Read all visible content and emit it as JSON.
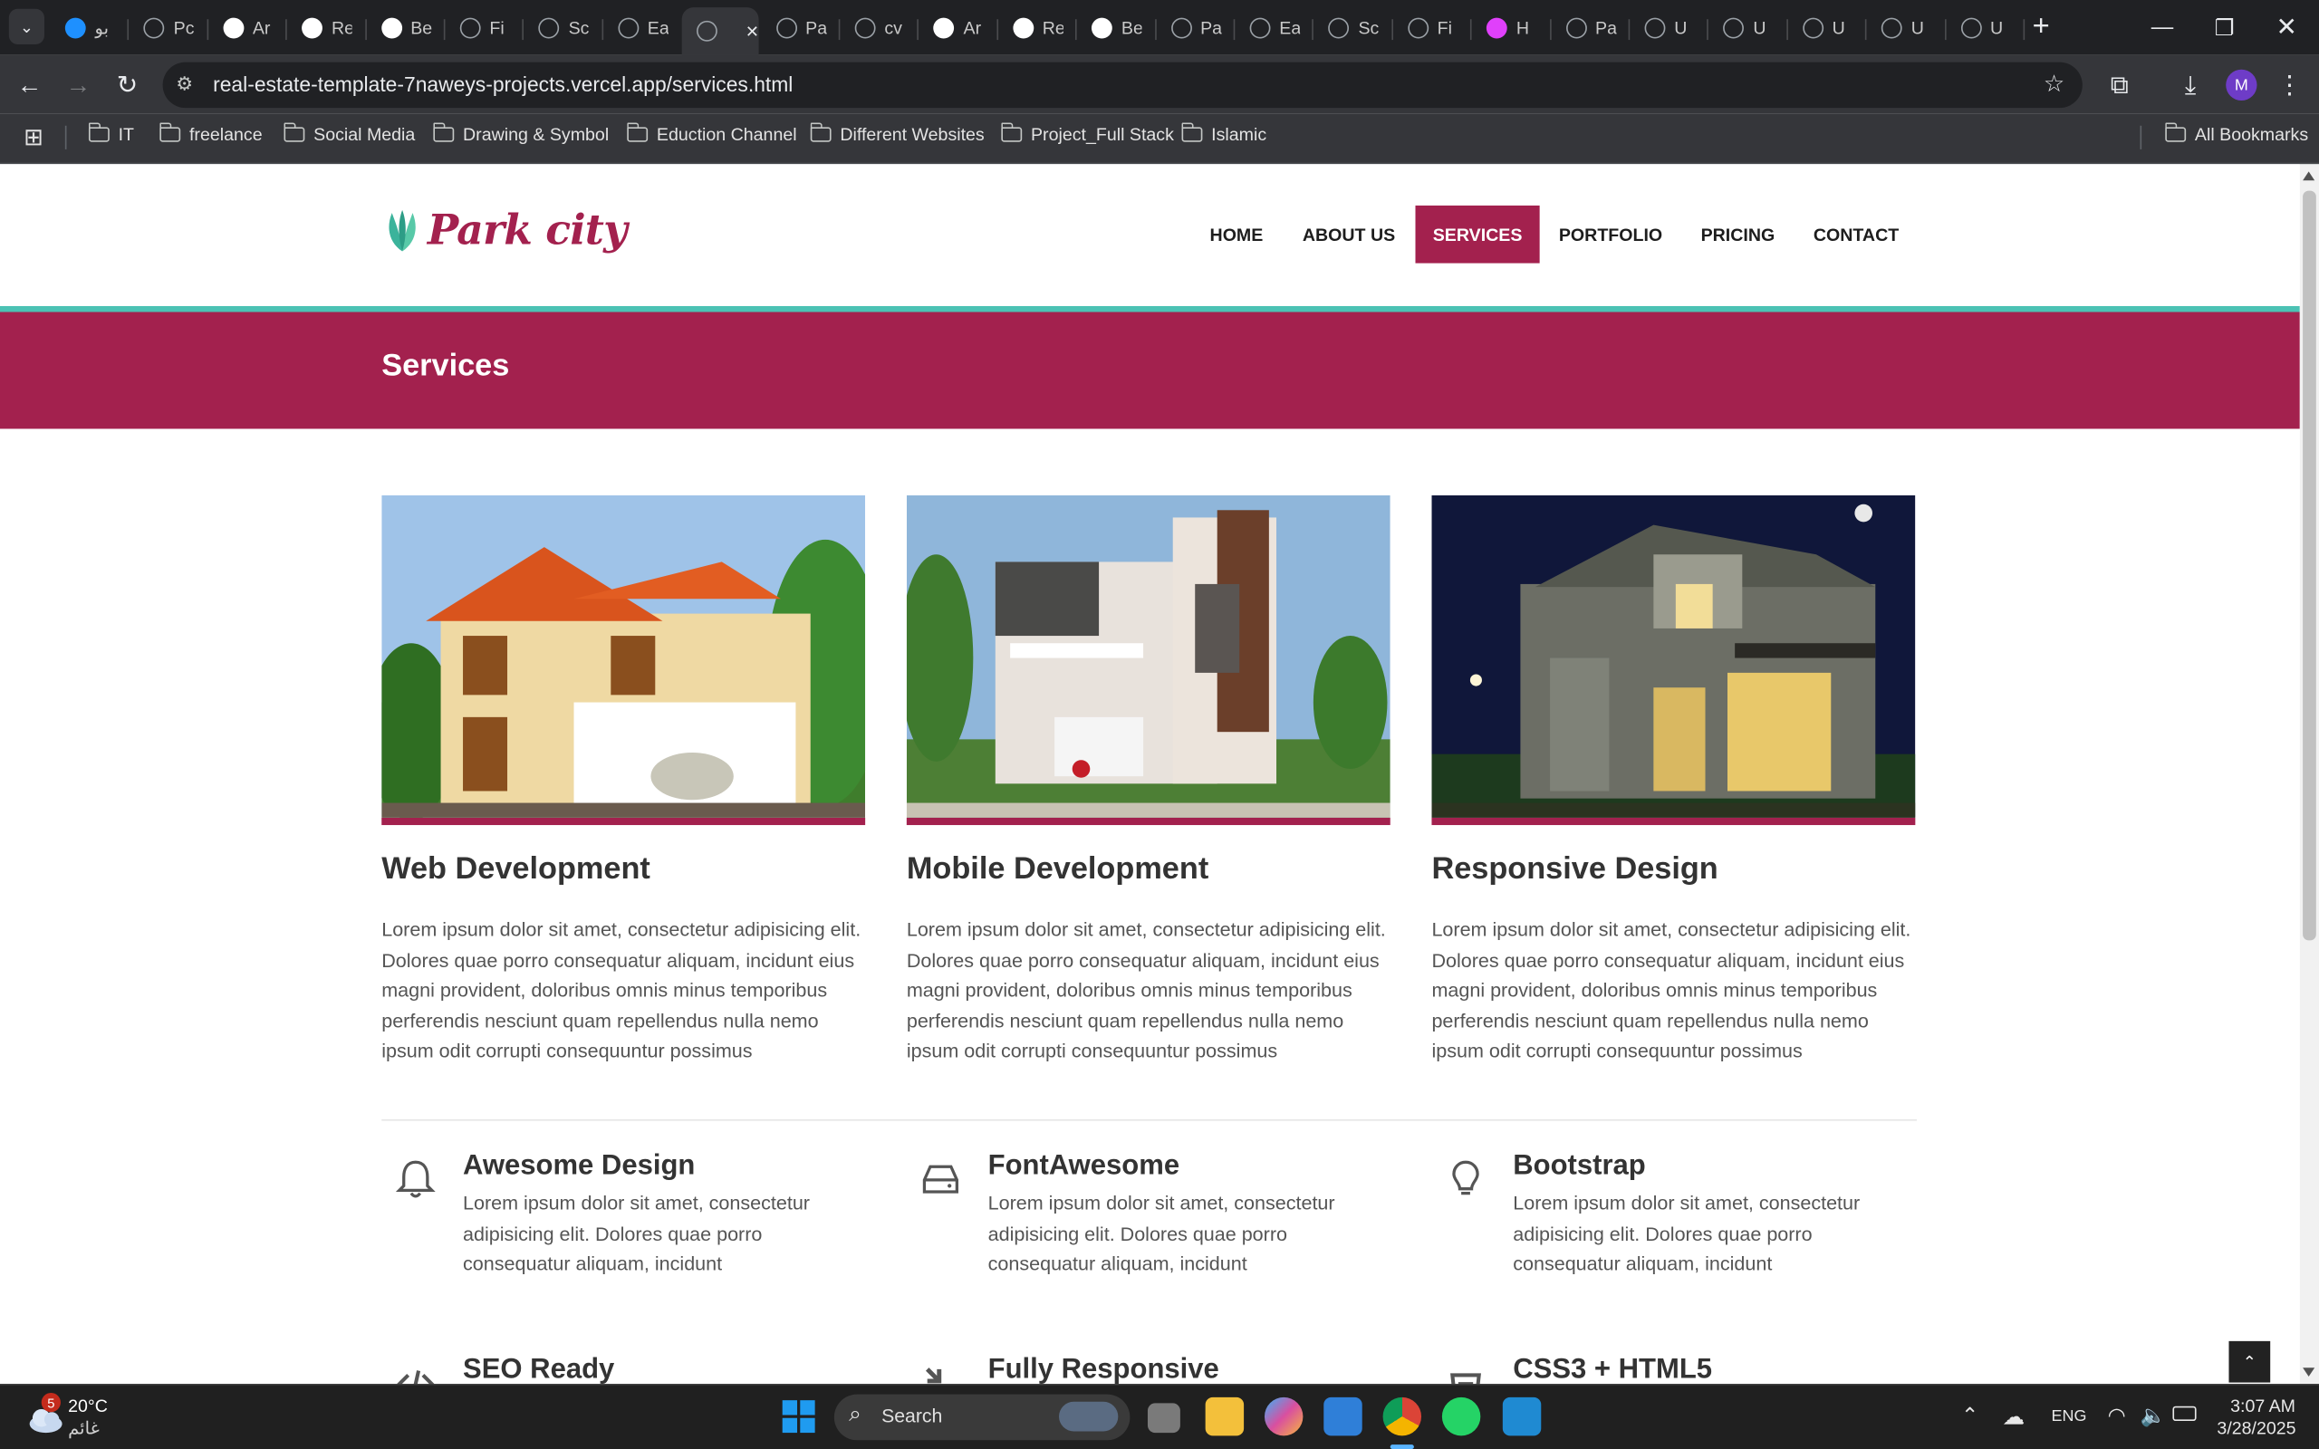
{
  "browser": {
    "tabs": [
      {
        "title": "بو",
        "icon_color": "#1e90ff",
        "icon": "circle-icon"
      },
      {
        "title": "Pc",
        "icon_color": "#9aa0a6",
        "icon": "globe-icon"
      },
      {
        "title": "Ar",
        "icon_color": "#ffffff",
        "icon": "tiktok-icon"
      },
      {
        "title": "Re",
        "icon_color": "#ffffff",
        "icon": "play-icon"
      },
      {
        "title": "Be",
        "icon_color": "#ffffff",
        "icon": "tiktok-icon"
      },
      {
        "title": "Fi",
        "icon_color": "#9aa0a6",
        "icon": "globe-icon"
      },
      {
        "title": "Sc",
        "icon_color": "#9aa0a6",
        "icon": "globe-icon"
      },
      {
        "title": "Ea",
        "icon_color": "#9aa0a6",
        "icon": "globe-icon"
      },
      {
        "title": "",
        "icon_color": "#9aa0a6",
        "icon": "globe-icon",
        "active": true
      },
      {
        "title": "Pa",
        "icon_color": "#9aa0a6",
        "icon": "globe-icon"
      },
      {
        "title": "cv",
        "icon_color": "#9aa0a6",
        "icon": "globe-icon"
      },
      {
        "title": "Ar",
        "icon_color": "#ffffff",
        "icon": "tiktok-icon"
      },
      {
        "title": "Re",
        "icon_color": "#ffffff",
        "icon": "play-icon"
      },
      {
        "title": "Be",
        "icon_color": "#ffffff",
        "icon": "tiktok-icon"
      },
      {
        "title": "Pa",
        "icon_color": "#9aa0a6",
        "icon": "globe-icon"
      },
      {
        "title": "Ea",
        "icon_color": "#9aa0a6",
        "icon": "globe-icon"
      },
      {
        "title": "Sc",
        "icon_color": "#9aa0a6",
        "icon": "globe-icon"
      },
      {
        "title": "Fi",
        "icon_color": "#9aa0a6",
        "icon": "globe-icon"
      },
      {
        "title": "H",
        "icon_color": "#e040fb",
        "icon": "angular-icon"
      },
      {
        "title": "Pa",
        "icon_color": "#9aa0a6",
        "icon": "globe-icon"
      },
      {
        "title": "U",
        "icon_color": "#9aa0a6",
        "icon": "globe-icon"
      },
      {
        "title": "U",
        "icon_color": "#9aa0a6",
        "icon": "globe-icon"
      },
      {
        "title": "U",
        "icon_color": "#9aa0a6",
        "icon": "globe-icon"
      },
      {
        "title": "U",
        "icon_color": "#9aa0a6",
        "icon": "globe-icon"
      },
      {
        "title": "U",
        "icon_color": "#9aa0a6",
        "icon": "globe-icon"
      }
    ],
    "url": "real-estate-template-7naweys-projects.vercel.app/services.html",
    "profile_initial": "M",
    "bookmarks": [
      "IT",
      "freelance",
      "Social Media",
      "Drawing & Symbol",
      "Eduction Channel",
      "Different Websites",
      "Project_Full Stack",
      "Islamic"
    ],
    "all_bookmarks": "All Bookmarks"
  },
  "site": {
    "logo_text": "Park city",
    "nav": [
      {
        "label": "HOME"
      },
      {
        "label": "ABOUT US"
      },
      {
        "label": "SERVICES",
        "active": true
      },
      {
        "label": "PORTFOLIO"
      },
      {
        "label": "PRICING"
      },
      {
        "label": "CONTACT"
      }
    ],
    "banner_title": "Services",
    "accent_color": "#a3214e",
    "header_stripe_color": "#4bc2b4",
    "cards": [
      {
        "title": "Web Development",
        "text": "Lorem ipsum dolor sit amet, consectetur adipisicing elit. Dolores quae porro consequatur aliquam, incidunt eius magni provident, doloribus omnis minus temporibus perferendis nesciunt quam repellendus nulla nemo ipsum odit corrupti consequuntur possimus"
      },
      {
        "title": "Mobile Development",
        "text": "Lorem ipsum dolor sit amet, consectetur adipisicing elit. Dolores quae porro consequatur aliquam, incidunt eius magni provident, doloribus omnis minus temporibus perferendis nesciunt quam repellendus nulla nemo ipsum odit corrupti consequuntur possimus"
      },
      {
        "title": "Responsive Design",
        "text": "Lorem ipsum dolor sit amet, consectetur adipisicing elit. Dolores quae porro consequatur aliquam, incidunt eius magni provident, doloribus omnis minus temporibus perferendis nesciunt quam repellendus nulla nemo ipsum odit corrupti consequuntur possimus"
      }
    ],
    "features": [
      {
        "title": "Awesome Design",
        "icon": "bell-icon",
        "text": "Lorem ipsum dolor sit amet, consectetur adipisicing elit. Dolores quae porro consequatur aliquam, incidunt"
      },
      {
        "title": "FontAwesome",
        "icon": "hdd-icon",
        "text": "Lorem ipsum dolor sit amet, consectetur adipisicing elit. Dolores quae porro consequatur aliquam, incidunt"
      },
      {
        "title": "Bootstrap",
        "icon": "lightbulb-icon",
        "text": "Lorem ipsum dolor sit amet, consectetur adipisicing elit. Dolores quae porro consequatur aliquam, incidunt"
      },
      {
        "title": "SEO Ready",
        "icon": "code-icon",
        "text": ""
      },
      {
        "title": "Fully Responsive",
        "icon": "compress-icon",
        "text": ""
      },
      {
        "title": "CSS3 + HTML5",
        "icon": "html5-icon",
        "text": ""
      }
    ],
    "back_to_top": "⌃"
  },
  "taskbar": {
    "weather_temp": "20°C",
    "weather_desc": "غائم",
    "weather_badge": "5",
    "search_label": "Search",
    "lang": "ENG",
    "time": "3:07 AM",
    "date": "3/28/2025"
  }
}
